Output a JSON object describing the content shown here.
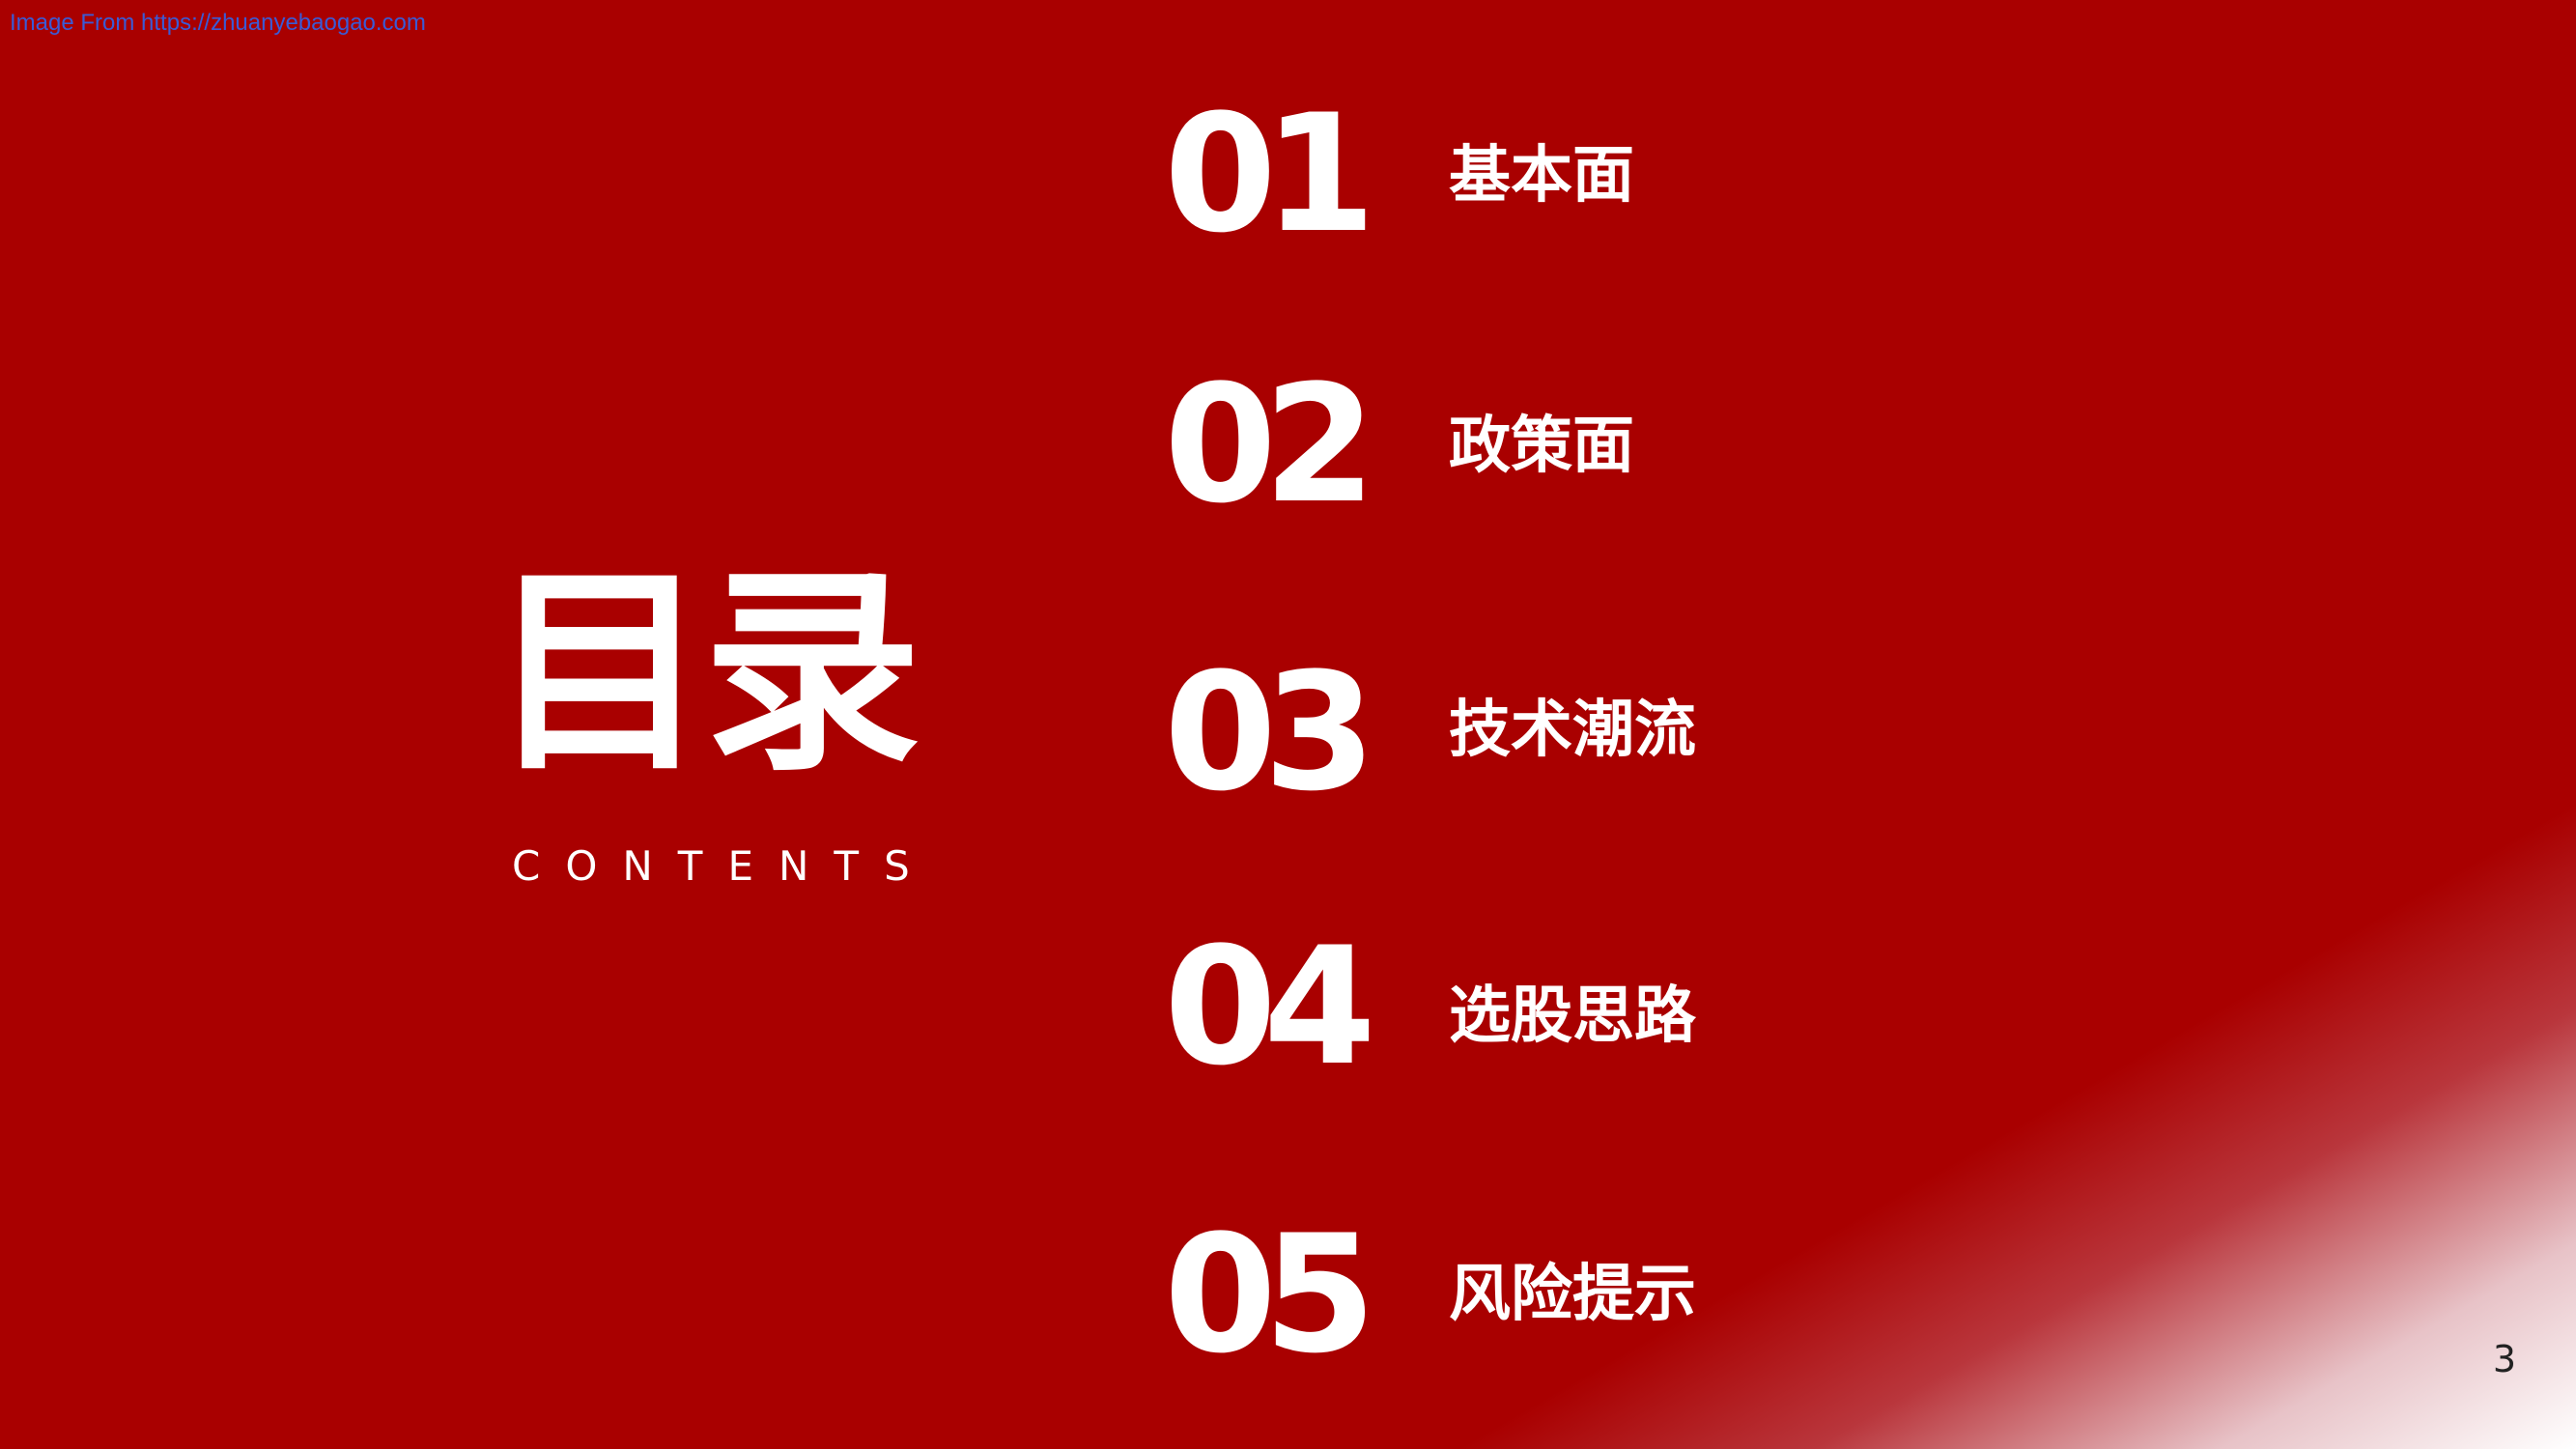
{
  "watermark": "Image From https://zhuanyebaogao.com",
  "title": "目录",
  "subtitle": "CONTENTS",
  "items": [
    {
      "number": "01",
      "label": "基本面"
    },
    {
      "number": "02",
      "label": "政策面"
    },
    {
      "number": "03",
      "label": "技术潮流"
    },
    {
      "number": "04",
      "label": "选股思路"
    },
    {
      "number": "05",
      "label": "风险提示"
    }
  ],
  "page_number": "3",
  "colors": {
    "background": "#a90000",
    "text": "#ffffff",
    "watermark": "#3a5bd6"
  }
}
